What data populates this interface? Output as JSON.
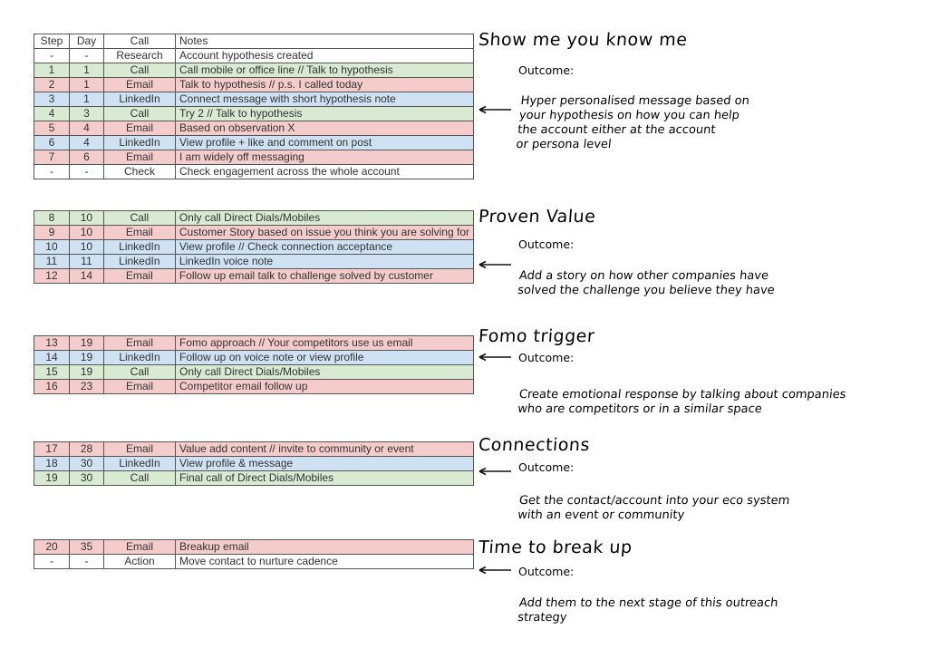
{
  "headers": [
    "Step",
    "Day",
    "Call",
    "Notes"
  ],
  "tables": [
    [
      [
        "-",
        "-",
        "Research",
        "Account hypothesis created",
        "white"
      ],
      [
        "1",
        "1",
        "Call",
        "Call mobile or office line // Talk to hypothesis",
        "green"
      ],
      [
        "2",
        "1",
        "Email",
        "Talk to hypothesis // p.s. I called today",
        "pink"
      ],
      [
        "3",
        "1",
        "LinkedIn",
        "Connect message with short hypothesis note",
        "blue"
      ],
      [
        "4",
        "3",
        "Call",
        "Try 2 // Talk to hypothesis",
        "green"
      ],
      [
        "5",
        "4",
        "Email",
        "Based on observation X",
        "pink"
      ],
      [
        "6",
        "4",
        "LinkedIn",
        "View profile + like and comment on post",
        "blue"
      ],
      [
        "7",
        "6",
        "Email",
        "I am widely off messaging",
        "pink"
      ],
      [
        "-",
        "-",
        "Check",
        "Check engagement across the whole account",
        "white"
      ]
    ],
    [
      [
        "8",
        "10",
        "Call",
        "Only call Direct Dials/Mobiles",
        "green"
      ],
      [
        "9",
        "10",
        "Email",
        "Customer Story based on issue you think you are solving for",
        "pink"
      ],
      [
        "10",
        "10",
        "LinkedIn",
        "View profile // Check connection acceptance",
        "blue"
      ],
      [
        "11",
        "11",
        "LinkedIn",
        "LinkedIn voice note",
        "blue"
      ],
      [
        "12",
        "14",
        "Email",
        "Follow up email talk to challenge solved by customer",
        "pink"
      ]
    ],
    [
      [
        "13",
        "19",
        "Email",
        "Fomo approach // Your competitors use us email",
        "pink"
      ],
      [
        "14",
        "19",
        "LinkedIn",
        "Follow up on voice note or view profile",
        "blue"
      ],
      [
        "15",
        "19",
        "Call",
        "Only call Direct Dials/Mobiles",
        "green"
      ],
      [
        "16",
        "23",
        "Email",
        "Competitor email follow up",
        "pink"
      ]
    ],
    [
      [
        "17",
        "28",
        "Email",
        "Value add content // invite to community or event",
        "pink"
      ],
      [
        "18",
        "30",
        "LinkedIn",
        "View profile & message",
        "blue"
      ],
      [
        "19",
        "30",
        "Call",
        "Final call of Direct Dials/Mobiles",
        "green"
      ]
    ],
    [
      [
        "20",
        "35",
        "Email",
        "Breakup email",
        "pink"
      ],
      [
        "-",
        "-",
        "Action",
        "Move contact to nurture cadence",
        "white"
      ]
    ]
  ],
  "sections": [
    {
      "title": "Show me you know me",
      "outcome": "Outcome:",
      "body": "Hyper personalised message based on\nyour hypothesis on how you can help\nthe account either at the account\nor persona level"
    },
    {
      "title": "Proven Value",
      "outcome": "Outcome:",
      "body": "Add a story on how other companies have\nsolved the challenge you believe they have"
    },
    {
      "title": "Fomo trigger",
      "outcome": "Outcome:",
      "body": "Create emotional response by talking about companies\nwho are competitors or in a similar space"
    },
    {
      "title": "Connections",
      "outcome": "Outcome:",
      "body": "Get the contact/account into your eco system\nwith an event or community"
    },
    {
      "title": "Time to break up",
      "outcome": "Outcome:",
      "body": "Add them to the next stage of this outreach\nstrategy"
    }
  ],
  "colors": {
    "green": "#d9ead3",
    "pink": "#f4cccc",
    "blue": "#cfe2f3"
  }
}
